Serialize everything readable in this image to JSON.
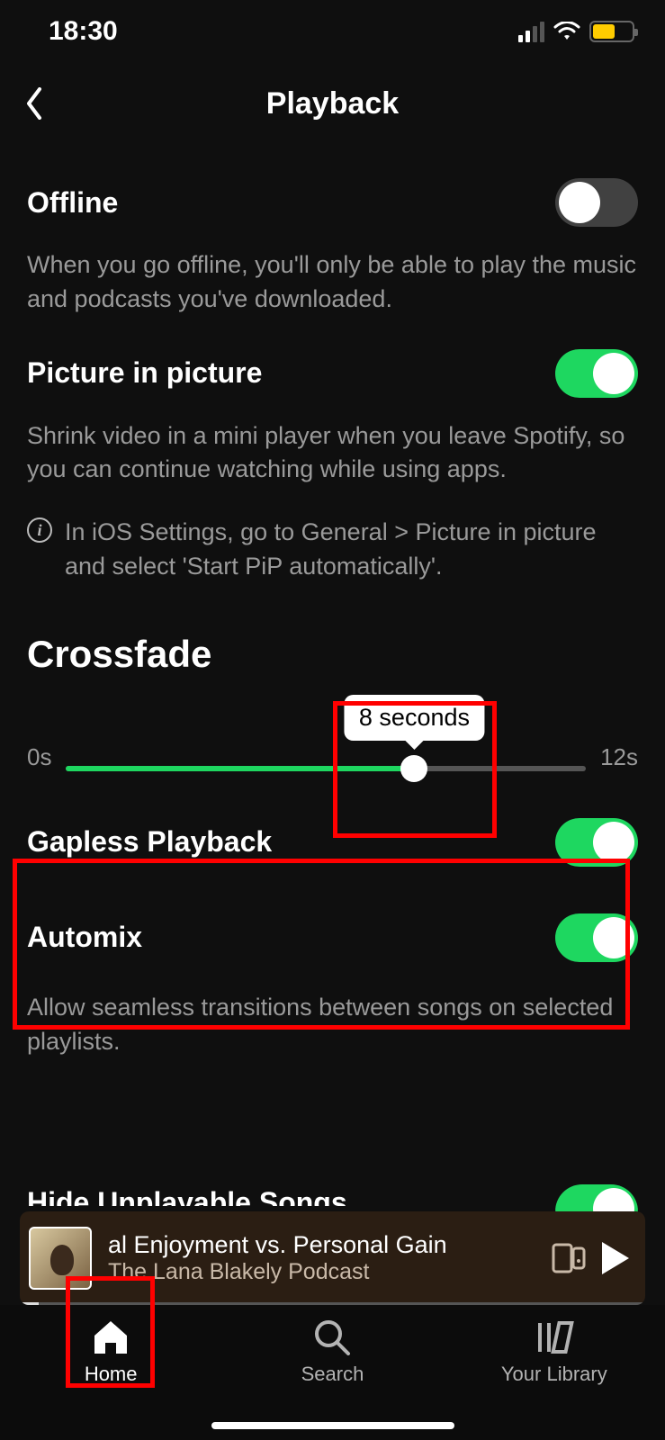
{
  "status": {
    "time": "18:30"
  },
  "header": {
    "title": "Playback"
  },
  "settings": {
    "offline": {
      "label": "Offline",
      "enabled": false,
      "description": "When you go offline, you'll only be able to play the music and podcasts you've downloaded."
    },
    "pip": {
      "label": "Picture in picture",
      "enabled": true,
      "description": "Shrink video in a mini player when you leave Spotify, so you can continue watching while using apps.",
      "info": "In iOS Settings, go to General > Picture in picture and select 'Start PiP automatically'."
    },
    "crossfade": {
      "heading": "Crossfade",
      "min_label": "0s",
      "max_label": "12s",
      "value_label": "8 seconds",
      "value": 8,
      "max": 12
    },
    "gapless": {
      "label": "Gapless Playback",
      "enabled": true
    },
    "automix": {
      "label": "Automix",
      "enabled": true,
      "description": "Allow seamless transitions between songs on selected playlists."
    },
    "hide_unplayable": {
      "label_partial": "Hide Unplayable Songs",
      "enabled": true
    }
  },
  "now_playing": {
    "title": "al Enjoyment vs. Personal Gain",
    "subtitle": "The Lana Blakely Podcast"
  },
  "tabs": {
    "home": "Home",
    "search": "Search",
    "library": "Your Library"
  }
}
